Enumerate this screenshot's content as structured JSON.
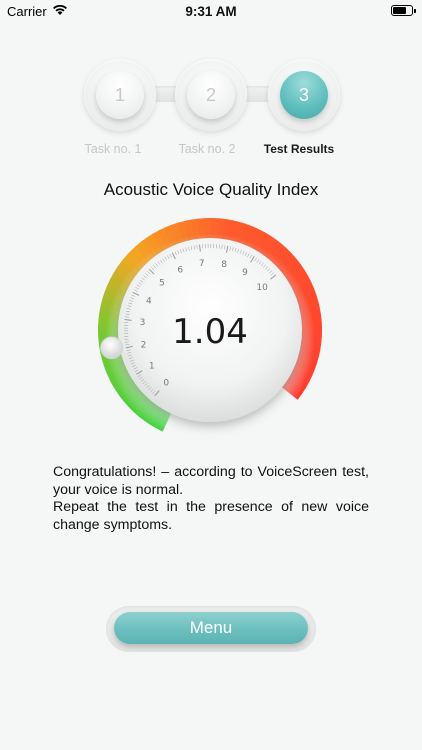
{
  "status_bar": {
    "carrier": "Carrier",
    "time": "9:31 AM"
  },
  "stepper": {
    "steps": [
      {
        "number": "1",
        "label": "Task no. 1",
        "state": "done"
      },
      {
        "number": "2",
        "label": "Task no. 2",
        "state": "done"
      },
      {
        "number": "3",
        "label": "Test Results",
        "state": "active"
      }
    ]
  },
  "gauge": {
    "title": "Acoustic Voice Quality Index",
    "value": "1.04",
    "numeric_value": 1.04,
    "min": 0,
    "max": 10,
    "ticks": [
      "0",
      "1",
      "2",
      "3",
      "4",
      "5",
      "6",
      "7",
      "8",
      "9",
      "10"
    ],
    "colors": {
      "good": "#3fd23f",
      "mid": "#f5a623",
      "bad": "#ff3b2f"
    }
  },
  "result": {
    "line1": "Congratulations! – according to VoiceScreen test, your voice is normal.",
    "line2": "Repeat the test in the presence of new voice change symptoms."
  },
  "menu": {
    "label": "Menu"
  },
  "colors": {
    "accent": "#5db3b3",
    "background": "#f5f6f6"
  }
}
